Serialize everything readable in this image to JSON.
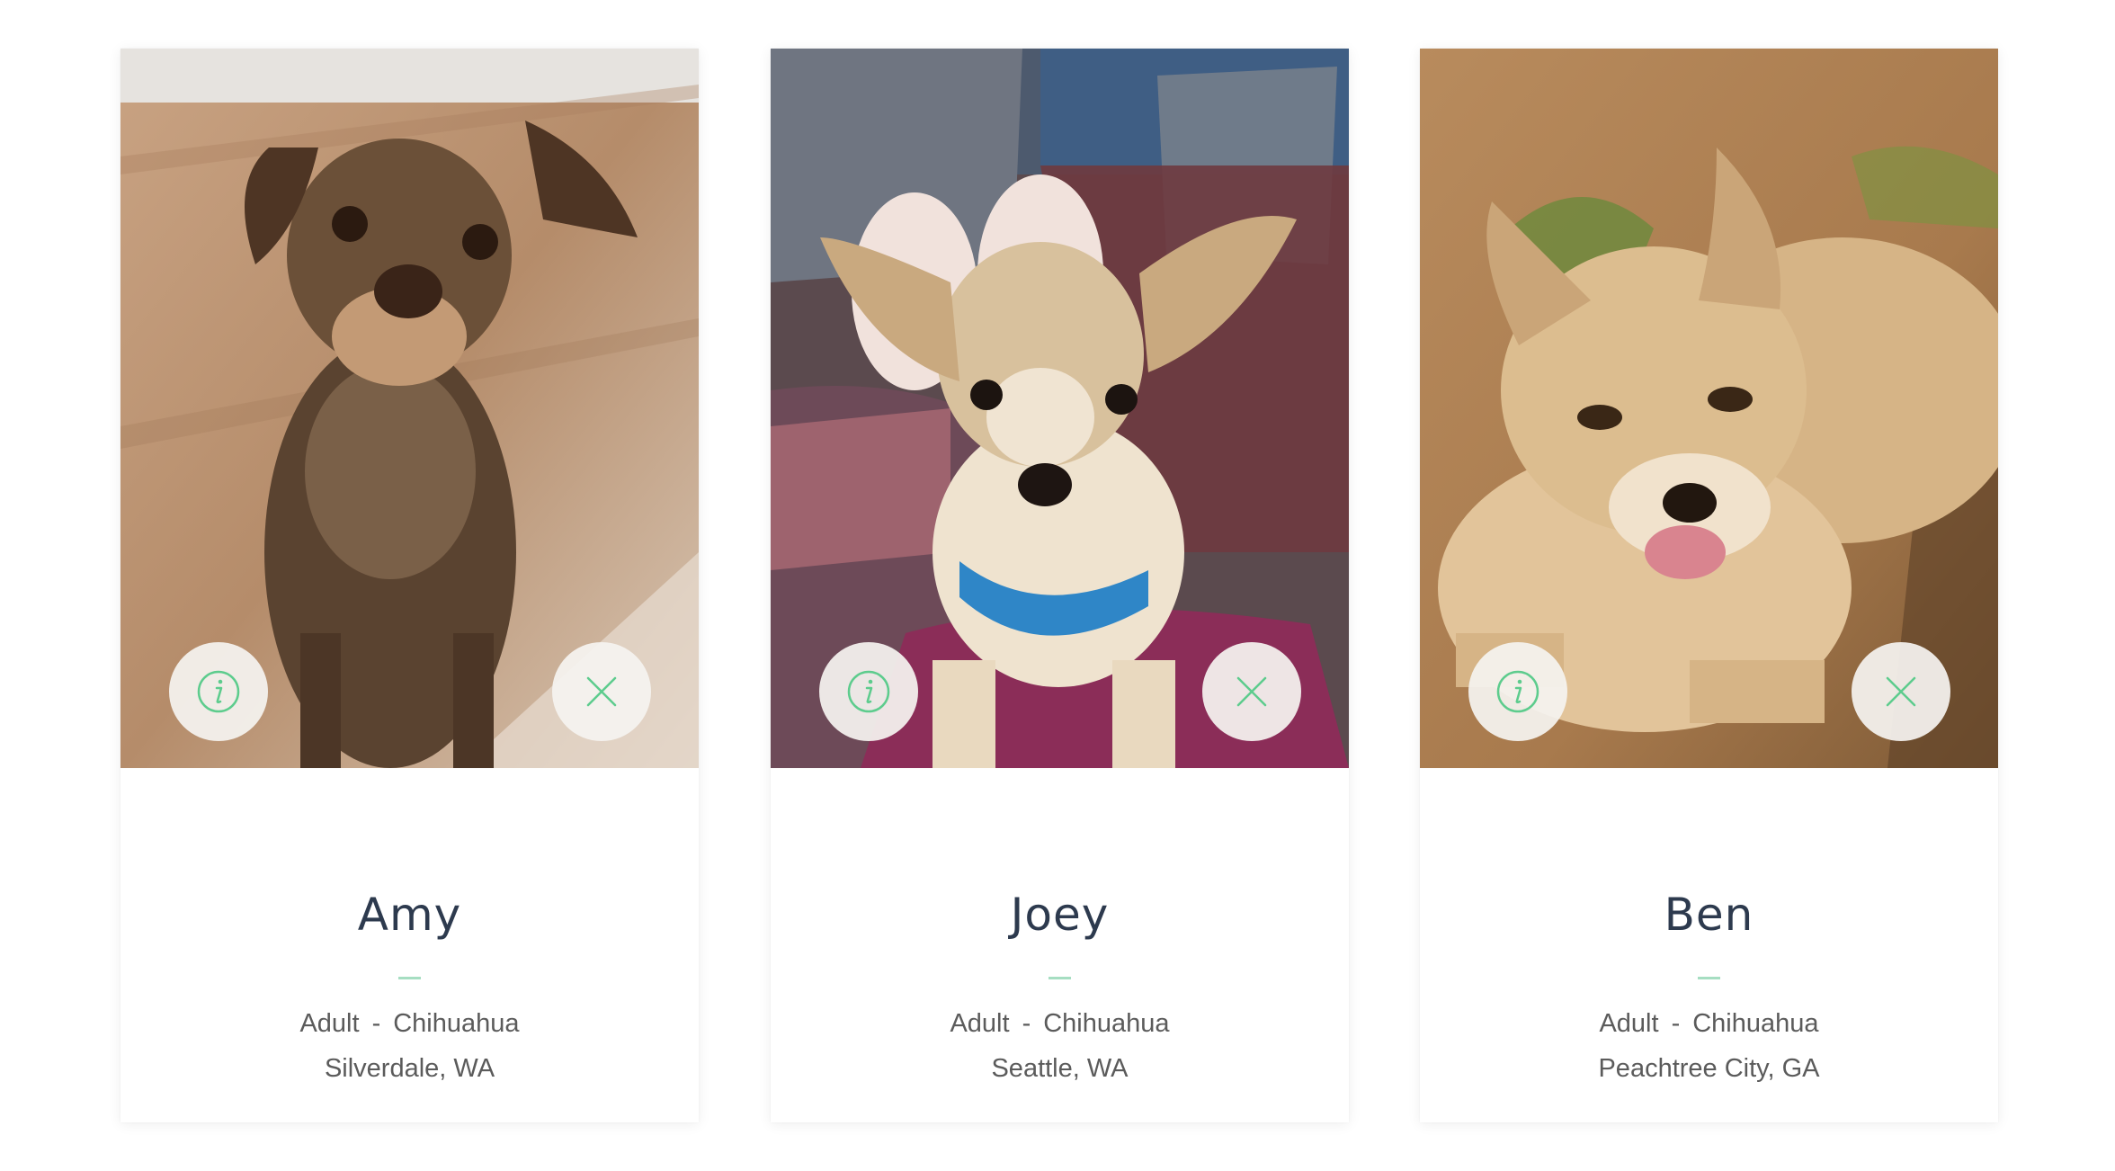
{
  "colors": {
    "accent_green": "#5dcc8d",
    "name_text": "#2d3a4e",
    "meta_text": "#5b5b5b",
    "divider": "#a6dec2"
  },
  "cards": [
    {
      "name": "Amy",
      "age": "Adult",
      "separator": "-",
      "breed": "Chihuahua",
      "location": "Silverdale, WA",
      "photo_icon": "dog-photo-brown-chihuahua-mix",
      "info_icon": "info-icon",
      "close_icon": "close-icon"
    },
    {
      "name": "Joey",
      "age": "Adult",
      "separator": "-",
      "breed": "Chihuahua",
      "location": "Seattle, WA",
      "photo_icon": "dog-photo-tan-chihuahua-blue-collar",
      "info_icon": "info-icon",
      "close_icon": "close-icon"
    },
    {
      "name": "Ben",
      "age": "Adult",
      "separator": "-",
      "breed": "Chihuahua",
      "location": "Peachtree City, GA",
      "photo_icon": "dog-photo-fawn-chihuahua-on-dirt",
      "info_icon": "info-icon",
      "close_icon": "close-icon"
    }
  ]
}
